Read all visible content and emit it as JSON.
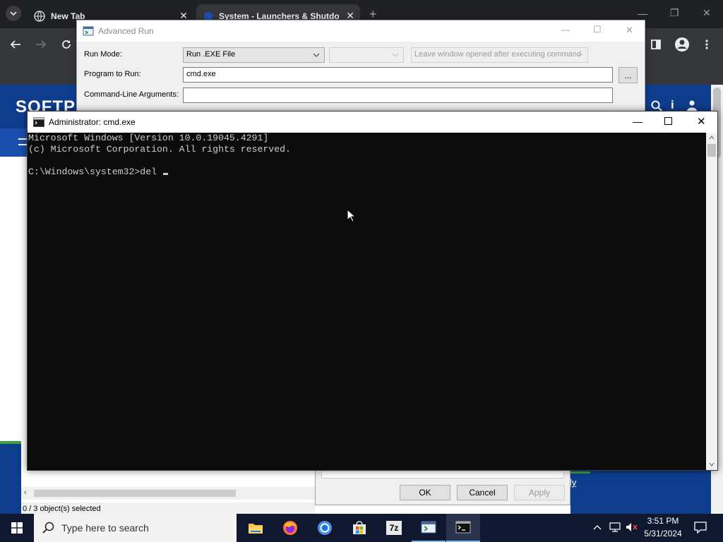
{
  "browser": {
    "tabs": [
      {
        "title": "New Tab",
        "active": false
      },
      {
        "title": "System - Launchers & Shutdow",
        "active": true
      }
    ],
    "new_tab_glyph": "+",
    "site_logo": "SOFTP",
    "icons": [
      "tab-search-icon",
      "back-icon",
      "forward-icon",
      "reload-icon",
      "sidepanel-icon",
      "profile-icon",
      "menu-icon"
    ]
  },
  "advanced_run": {
    "title": "Advanced Run",
    "run_mode_label": "Run Mode:",
    "run_mode_value": "Run .EXE File",
    "leave_window_value": "Leave window opened after executing command",
    "program_label": "Program to Run:",
    "program_value": "cmd.exe",
    "browse_label": "...",
    "args_label": "Command-Line Arguments:",
    "args_value": ""
  },
  "dialog_buttons": {
    "ok": "OK",
    "cancel": "Cancel",
    "apply": "Apply"
  },
  "status_bar": {
    "text": "0 / 3 object(s) selected"
  },
  "partial_link": "ly",
  "cmd": {
    "title": "Administrator: cmd.exe",
    "lines": [
      "Microsoft Windows [Version 10.0.19045.4291]",
      "(c) Microsoft Corporation. All rights reserved.",
      "",
      "C:\\Windows\\system32>del "
    ]
  },
  "taskbar": {
    "search_placeholder": "Type here to search",
    "apps": [
      "file-explorer-icon",
      "firefox-icon",
      "chrome-icon",
      "store-icon",
      "7zip-icon",
      "advancedrun-icon",
      "cmd-icon"
    ],
    "sevenzip_label": "7z",
    "time": "3:51 PM",
    "date": "5/31/2024"
  },
  "colors": {
    "taskbar": "#101830",
    "cmd_bg": "#0c0c0c",
    "cmd_text": "#cccccc",
    "site_blue": "#0f3d8e"
  }
}
